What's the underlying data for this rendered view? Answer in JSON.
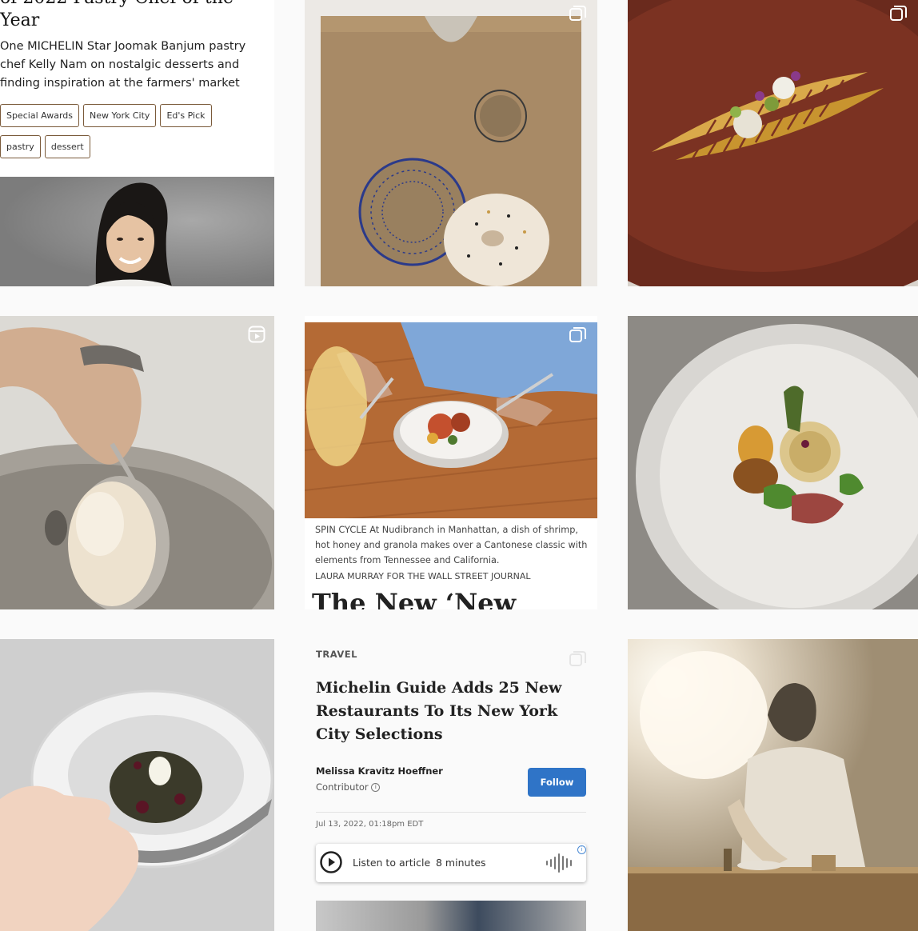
{
  "tile1": {
    "title_partial": "of 2022 Pastry Chef of the",
    "title_line2": "Year",
    "description": "One MICHELIN Star Joomak Banjum pastry chef Kelly Nam on nostalgic desserts and finding inspiration at the farmers' market",
    "tags": [
      "Special Awards",
      "New York City",
      "Ed's Pick",
      "pastry",
      "dessert"
    ]
  },
  "tile2": {
    "icon": "multi-photo-icon"
  },
  "tile3": {
    "icon": "multi-photo-icon"
  },
  "tile4": {
    "icon": "reels-icon"
  },
  "tile5": {
    "icon": "multi-photo-icon",
    "caption": "SPIN CYCLE At Nudibranch in Manhattan, a dish of shrimp, hot honey and granola makes over a Cantonese classic with elements from Tennessee and California.",
    "credit": "LAURA MURRAY FOR THE WALL STREET JOURNAL",
    "headline_partial": "The New ‘New"
  },
  "tile8": {
    "icon": "multi-photo-icon",
    "section": "TRAVEL",
    "headline": "Michelin Guide Adds 25 New Restaurants To Its New York City Selections",
    "author": "Melissa Kravitz Hoeffner",
    "role": "Contributor",
    "follow_label": "Follow",
    "date": "Jul 13, 2022, 01:18pm EDT",
    "listen_label": "Listen to article",
    "listen_duration": "8 minutes"
  },
  "colors": {
    "follow_button": "#2f74c7",
    "tag_border": "#7a5a3a"
  }
}
